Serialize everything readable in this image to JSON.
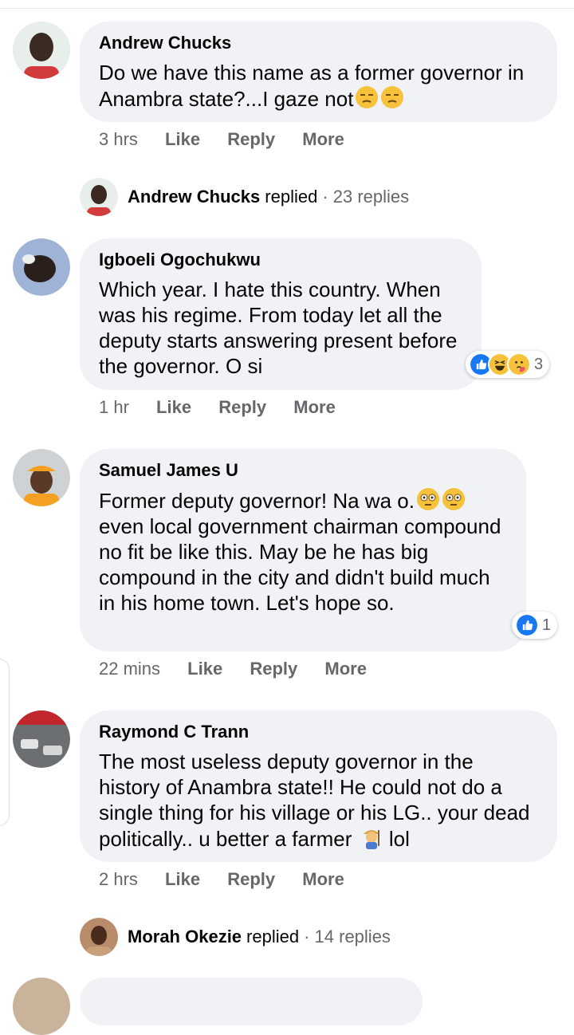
{
  "comments": [
    {
      "author": "Andrew Chucks",
      "text": "Do we have this name as a former governor in Anambra state?...I gaze not",
      "emoji": [
        "unamused-face",
        "unamused-face"
      ],
      "time": "3 hrs",
      "reaction_count": null,
      "reply_summary": {
        "author": "Andrew Chucks",
        "word": "replied",
        "count": "· 23 replies"
      }
    },
    {
      "author": "Igboeli Ogochukwu",
      "text": "Which year. I hate this country. When was his regime. From today let all the deputy starts answering present before the governor. O si",
      "time": "1 hr",
      "reactions": [
        "like",
        "haha",
        "care"
      ],
      "reaction_count": "3"
    },
    {
      "author": "Samuel James U",
      "text_before_emoji": "Former deputy governor! Na wa o.",
      "emoji": [
        "flushed-face",
        "flushed-face"
      ],
      "text_after_emoji": "even local government chairman compound no fit be like this. May be he has big compound in the city and didn't build much in his home town. Let's hope so.",
      "time": "22 mins",
      "reactions": [
        "like"
      ],
      "reaction_count": "1"
    },
    {
      "author": "Raymond C Trann",
      "text_before_emoji": "The most useless deputy governor in the history of Anambra state!! He could not do a single thing for his village or his LG.. your dead politically.. u better a farmer",
      "emoji": [
        "farmer"
      ],
      "text_after_emoji": "lol",
      "time": "2 hrs",
      "reply_summary": {
        "author": "Morah Okezie",
        "word": "replied",
        "count": "· 14 replies"
      }
    }
  ],
  "actions": {
    "like": "Like",
    "reply": "Reply",
    "more": "More"
  },
  "colors": {
    "bubble": "#f0f2f5",
    "meta": "#65676b",
    "like_blue": "#1877f2"
  }
}
